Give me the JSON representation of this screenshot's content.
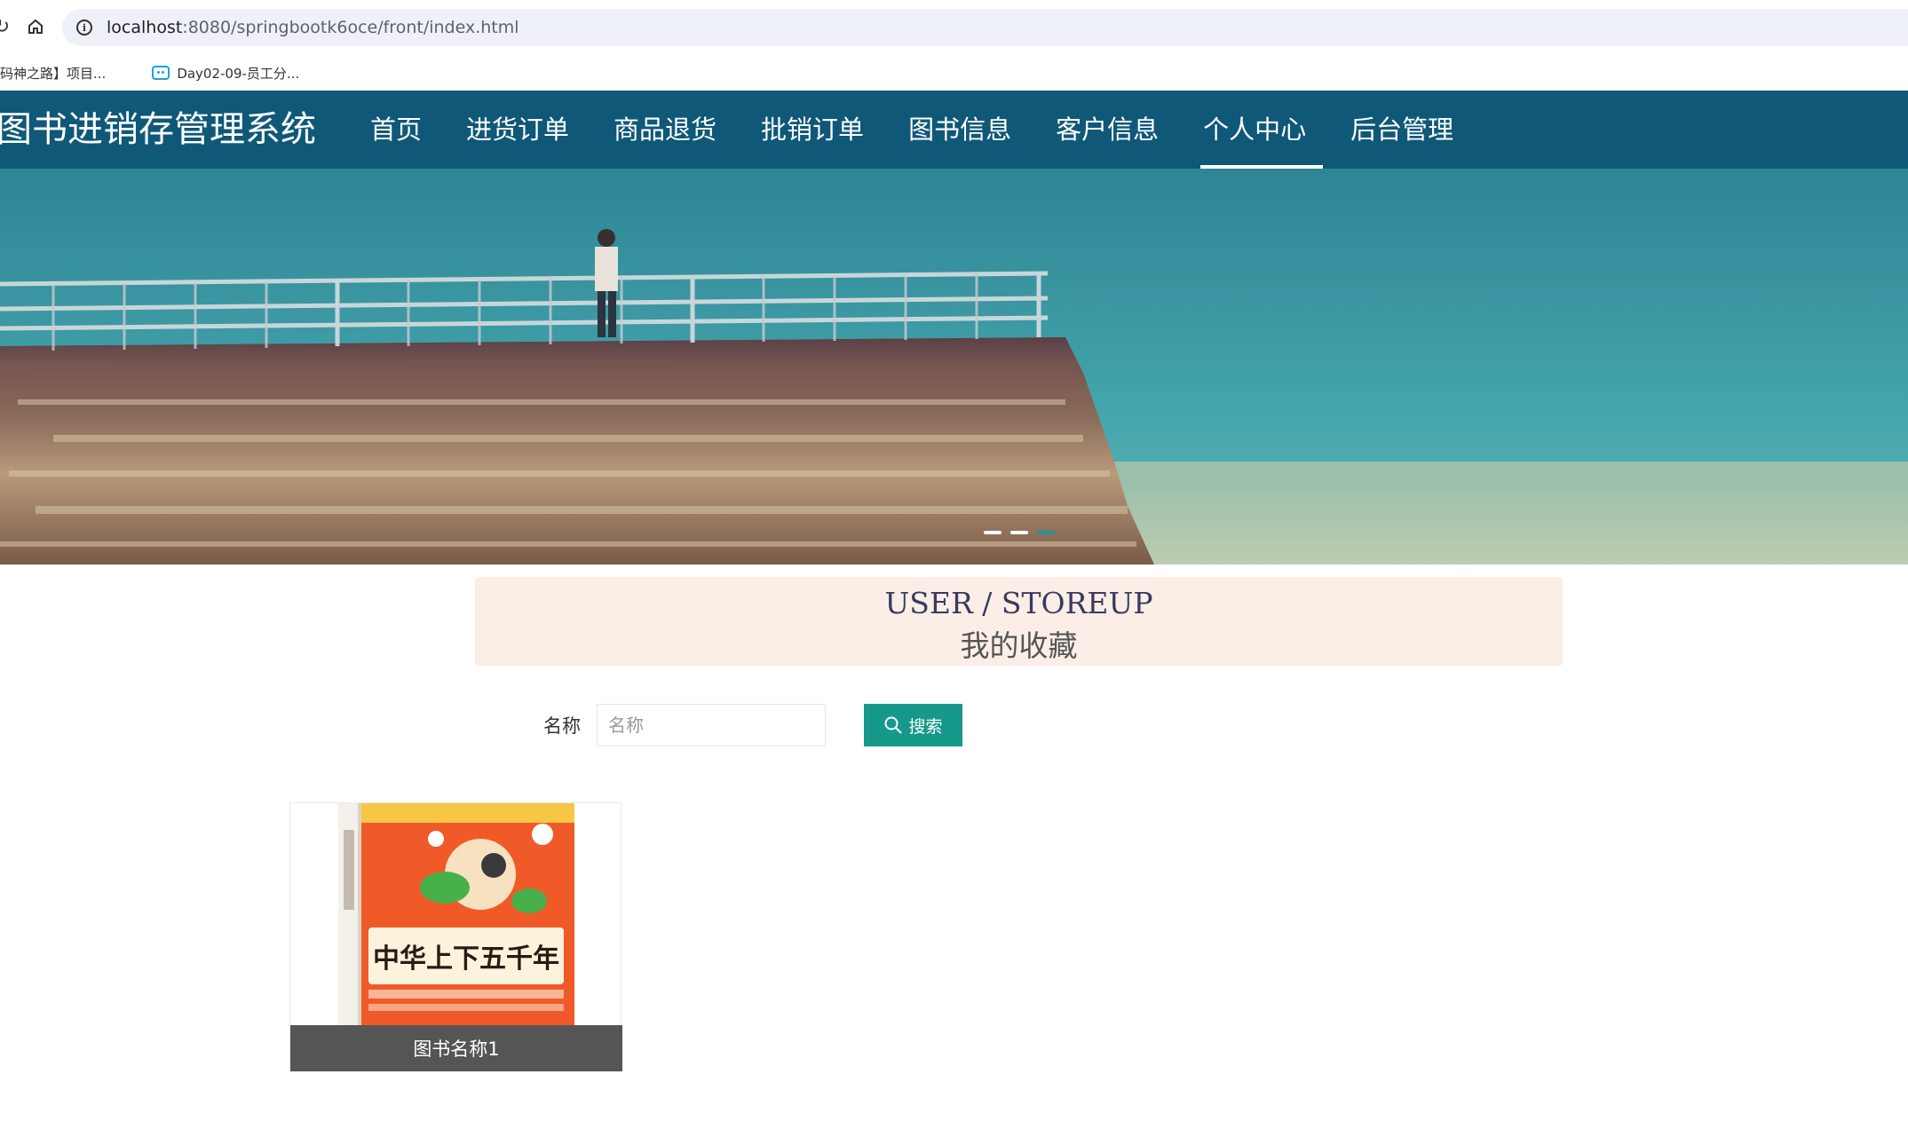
{
  "browser": {
    "url_host": "localhost",
    "url_path": ":8080/springbootk6oce/front/index.html",
    "bookmarks": [
      {
        "label": "码神之路】项目..."
      },
      {
        "label": "Day02-09-员工分..."
      }
    ]
  },
  "header": {
    "site_title": "图书进销存管理系统",
    "menu": [
      {
        "label": "首页"
      },
      {
        "label": "进货订单"
      },
      {
        "label": "商品退货"
      },
      {
        "label": "批销订单"
      },
      {
        "label": "图书信息"
      },
      {
        "label": "客户信息"
      },
      {
        "label": "个人中心"
      },
      {
        "label": "后台管理"
      }
    ],
    "active_index": 6
  },
  "carousel": {
    "slide_count": 3,
    "active_index": 2
  },
  "section": {
    "title_en": "USER / STOREUP",
    "title_cn": "我的收藏"
  },
  "search": {
    "label": "名称",
    "placeholder": "名称",
    "value": "",
    "button_label": "搜索"
  },
  "items": [
    {
      "name": "图书名称1",
      "cover_title": "中华上下五千年"
    }
  ],
  "colors": {
    "header_bg": "#0f5878",
    "search_button": "#16998a",
    "section_bg": "#fbeee7",
    "caption_bg": "#555555"
  }
}
